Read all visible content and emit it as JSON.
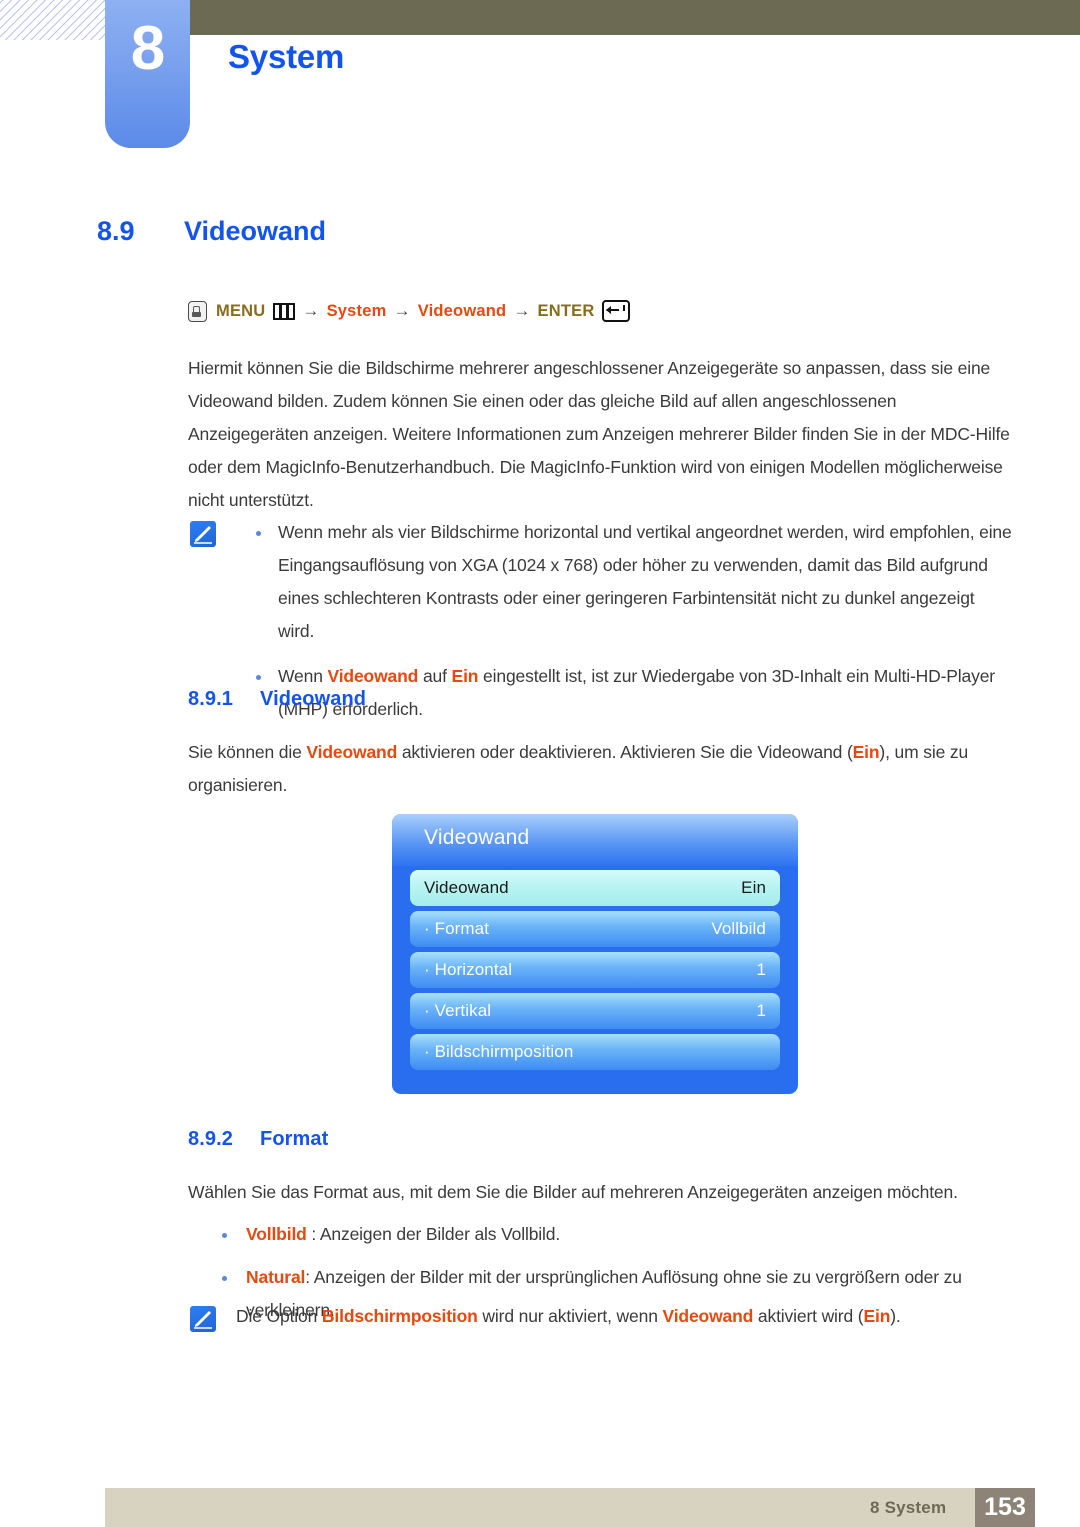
{
  "chapter": {
    "number": "8",
    "title": "System"
  },
  "section": {
    "number": "8.9",
    "title": "Videowand"
  },
  "menu_path": {
    "hand_icon": "hand-press-icon",
    "menu_label": "MENU",
    "menu_icon": "menu-bars-icon",
    "arrow1": "→",
    "item1": "System",
    "arrow2": "→",
    "item2": "Videowand",
    "arrow3": "→",
    "enter_label": "ENTER",
    "enter_icon": "enter-return-icon"
  },
  "intro_paragraph": "Hiermit können Sie die Bildschirme mehrerer angeschlossener Anzeigegeräte so anpassen, dass sie eine Videowand bilden. Zudem können Sie einen oder das gleiche Bild auf allen angeschlossenen Anzeigegeräten anzeigen. Weitere Informationen zum Anzeigen mehrerer Bilder finden Sie in der MDC-Hilfe oder dem MagicInfo-Benutzerhandbuch. Die MagicInfo-Funktion wird von einigen Modellen möglicherweise nicht unterstützt.",
  "note1": {
    "icon": "note-pencil-icon",
    "bullets": [
      "Wenn mehr als vier Bildschirme horizontal und vertikal angeordnet werden, wird empfohlen, eine Eingangsauflösung von XGA (1024 x 768) oder höher zu verwenden, damit das Bild aufgrund eines schlechteren Kontrasts oder einer geringeren Farbintensität nicht zu dunkel angezeigt wird."
    ]
  },
  "note1_bullet2": {
    "prefix": "Wenn ",
    "hl1": "Videowand",
    "mid": " auf ",
    "hl2": "Ein",
    "suffix": " eingestellt ist, ist zur Wiedergabe von 3D-Inhalt ein Multi-HD-Player (MHP) erforderlich."
  },
  "subsection_891": {
    "number": "8.9.1",
    "title": "Videowand",
    "text_a": "Sie können die ",
    "hl1": "Videowand",
    "text_b": " aktivieren oder deaktivieren. Aktivieren Sie die Videowand (",
    "hl2": "Ein",
    "text_c": "), um sie zu organisieren."
  },
  "osd": {
    "title": "Videowand",
    "rows": [
      {
        "label": "Videowand",
        "value": "Ein",
        "selected": true
      },
      {
        "label": "· Format",
        "value": "Vollbild",
        "selected": false
      },
      {
        "label": "· Horizontal",
        "value": "1",
        "selected": false
      },
      {
        "label": "· Vertikal",
        "value": "1",
        "selected": false
      },
      {
        "label": "· Bildschirmposition",
        "value": "",
        "selected": false
      }
    ]
  },
  "subsection_892": {
    "number": "8.9.2",
    "title": "Format",
    "intro": "Wählen Sie das Format aus, mit dem Sie die Bilder auf mehreren Anzeigegeräten anzeigen möchten.",
    "bullet1_hl": "Vollbild",
    "bullet1_rest": " : Anzeigen der Bilder als Vollbild.",
    "bullet2_hl": "Natural",
    "bullet2_rest": ": Anzeigen der Bilder mit der ursprünglichen Auflösung ohne sie zu vergrößern oder zu verkleinern."
  },
  "note2": {
    "icon": "note-pencil-icon",
    "text_a": "Die Option ",
    "hl1": "Bildschirmposition",
    "text_b": " wird nur aktiviert, wenn ",
    "hl2": "Videowand",
    "text_c": " aktiviert wird (",
    "hl3": "Ein",
    "text_d": ")."
  },
  "footer": {
    "text": "8 System",
    "page": "153"
  },
  "colors": {
    "heading_blue": "#1155ee",
    "highlight_orange": "#e8490f",
    "olive": "#8a6d1c",
    "header_bar": "#6d6a54",
    "tab_blue": "#7ea4ef",
    "footer_bar": "#d8d3c0",
    "page_box": "#8d8477",
    "osd_bg": "#2a6ef0"
  }
}
